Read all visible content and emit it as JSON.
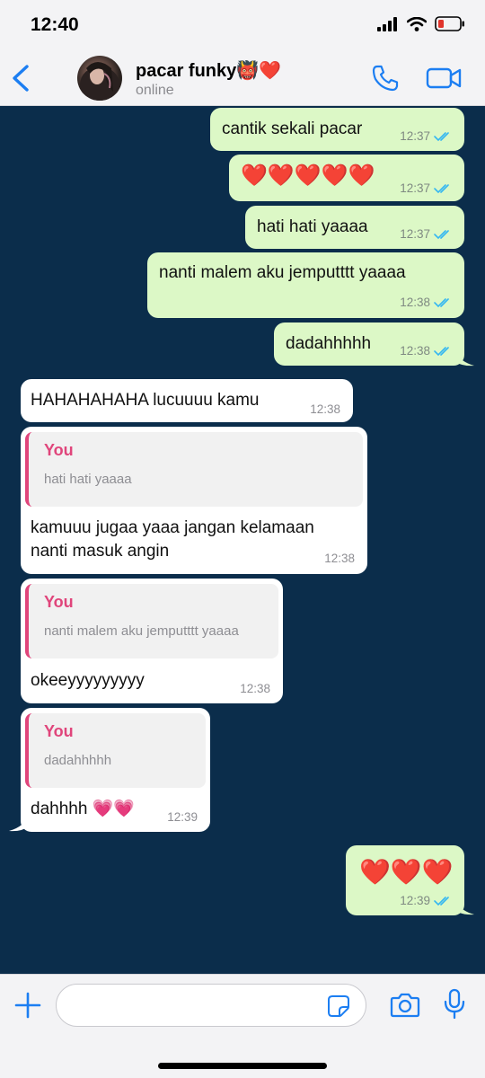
{
  "status_bar": {
    "time": "12:40"
  },
  "header": {
    "contact_name": "pacar funky👹❤️",
    "contact_status": "online"
  },
  "messages": [
    {
      "direction": "outgoing",
      "text": "cantik sekali pacar",
      "time": "12:37",
      "read": true
    },
    {
      "direction": "outgoing",
      "text": "❤️❤️❤️❤️❤️",
      "time": "12:37",
      "read": true
    },
    {
      "direction": "outgoing",
      "text": "hati hati yaaaa",
      "time": "12:37",
      "read": true
    },
    {
      "direction": "outgoing",
      "text": "nanti malem aku jemputttt yaaaa",
      "time": "12:38",
      "read": true
    },
    {
      "direction": "outgoing",
      "text": "dadahhhhh",
      "time": "12:38",
      "read": true
    },
    {
      "direction": "incoming",
      "text": "HAHAHAHAHA lucuuuu kamu",
      "time": "12:38"
    },
    {
      "direction": "incoming",
      "reply_to": {
        "author": "You",
        "text": "hati hati yaaaa"
      },
      "text_line1": "kamuuu jugaa yaaa jangan kelamaan",
      "text_line2": "nanti masuk angin",
      "time": "12:38"
    },
    {
      "direction": "incoming",
      "reply_to": {
        "author": "You",
        "text": "nanti malem aku jemputttt yaaaa"
      },
      "text": "okeeyyyyyyyyy",
      "time": "12:38"
    },
    {
      "direction": "incoming",
      "reply_to": {
        "author": "You",
        "text": "dadahhhhh"
      },
      "text": "dahhhh 💗💗",
      "time": "12:39"
    },
    {
      "direction": "outgoing",
      "text": "❤️❤️❤️",
      "time": "12:39",
      "read": true
    }
  ],
  "input": {
    "value": "",
    "placeholder": ""
  },
  "icons": {
    "back": "chevron-left-icon",
    "call": "phone-icon",
    "video": "video-camera-icon",
    "plus": "plus-icon",
    "sticker": "sticker-icon",
    "camera": "camera-icon",
    "mic": "microphone-icon"
  },
  "colors": {
    "chat_background": "#0b2d4b",
    "outgoing_bubble": "#dcf8c6",
    "incoming_bubble": "#ffffff",
    "accent": "#1c7ef2",
    "read_tick": "#34b7f1",
    "reply_author": "#e0457b"
  }
}
